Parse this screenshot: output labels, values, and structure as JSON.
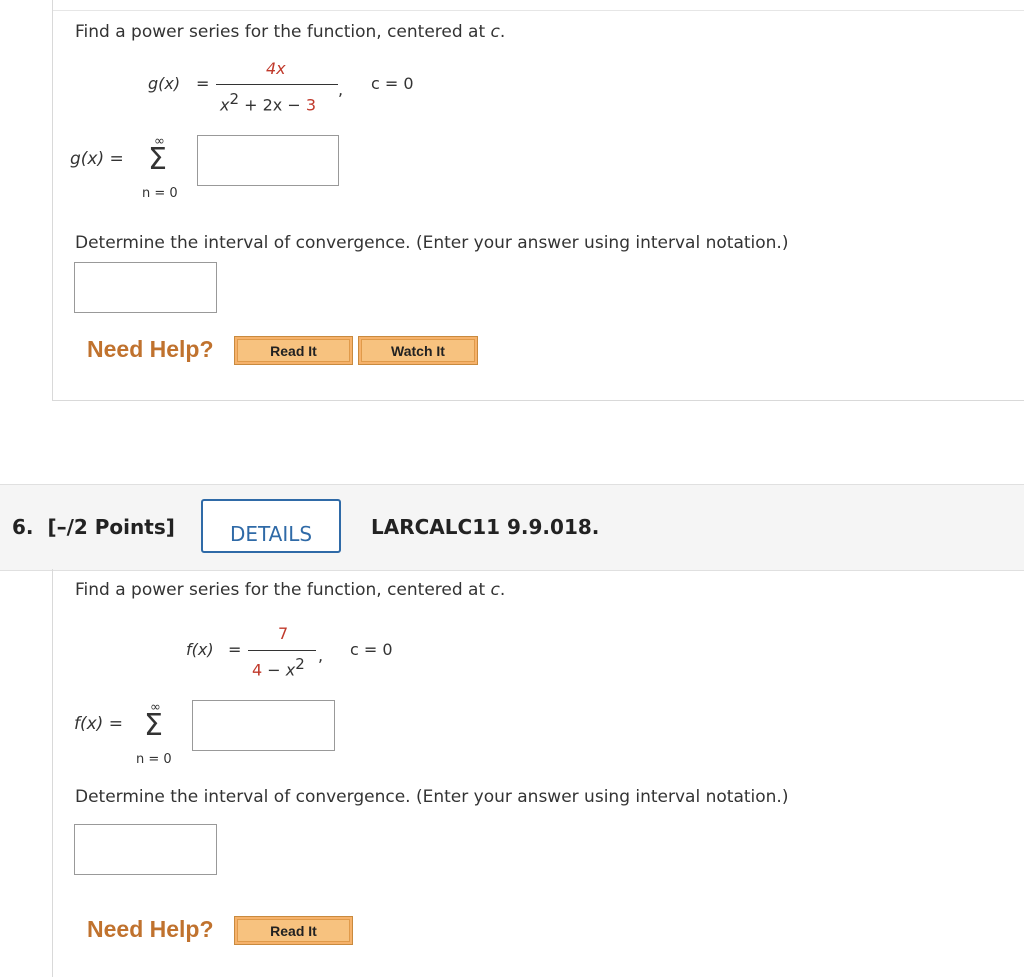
{
  "problem5": {
    "instruction_prefix": "Find a power series for the function, centered at ",
    "instruction_c": "c",
    "instruction_suffix": ".",
    "func_lhs": "g(x)",
    "equals": "=",
    "numerator": "4x",
    "denominator_x": "x",
    "denominator_exp": "2",
    "denominator_rest": " + 2x − ",
    "denominator_const": "3",
    "comma": ",",
    "center_label": "c = 0",
    "series_lhs": "g(x)",
    "sigma_upper": "∞",
    "sigma": "Σ",
    "sigma_lower": "n = 0",
    "series_input_value": "",
    "interval_prompt": "Determine the interval of convergence. (Enter your answer using interval notation.)",
    "interval_input_value": "",
    "need_help": "Need Help?",
    "read_it": "Read It",
    "watch_it": "Watch It"
  },
  "problem6": {
    "number_label": "6.",
    "points_label": "[–/2 Points]",
    "details_label": "DETAILS",
    "code": "LARCALC11 9.9.018.",
    "instruction_prefix": "Find a power series for the function, centered at ",
    "instruction_c": "c",
    "instruction_suffix": ".",
    "func_lhs": "f(x)",
    "equals": "=",
    "numerator": "7",
    "denominator_const": "4",
    "denominator_rest": " − x",
    "denominator_exp": "2",
    "comma": ",",
    "center_label": "c = 0",
    "series_lhs": "f(x)",
    "sigma_upper": "∞",
    "sigma": "Σ",
    "sigma_lower": "n = 0",
    "series_input_value": "",
    "interval_prompt": "Determine the interval of convergence. (Enter your answer using interval notation.)",
    "interval_input_value": "",
    "need_help": "Need Help?",
    "read_it": "Read It"
  }
}
